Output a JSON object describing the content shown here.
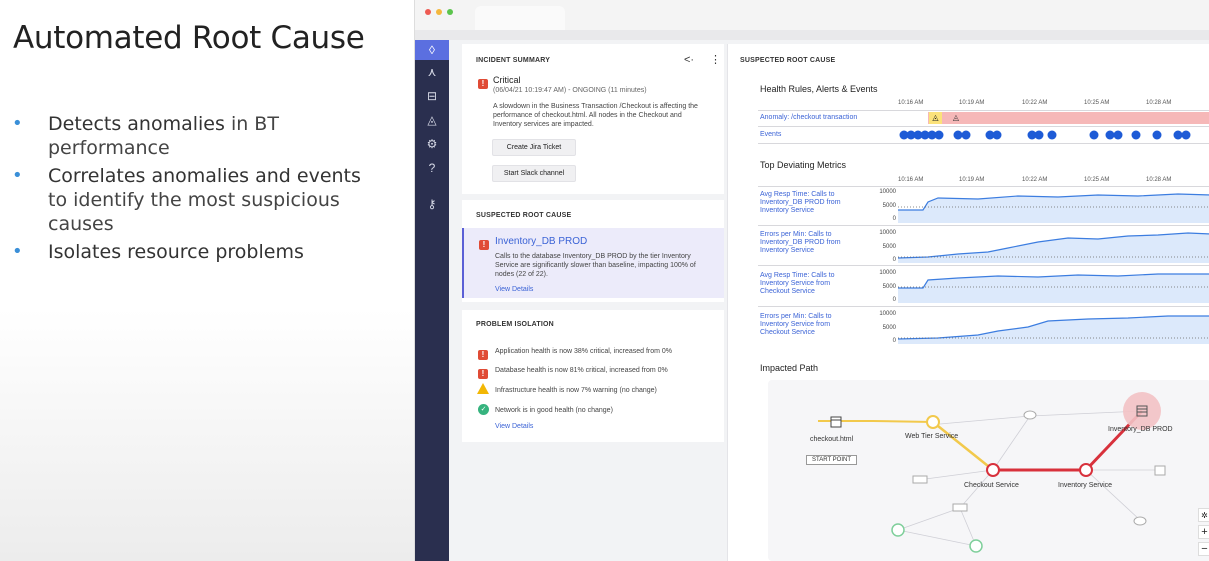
{
  "slide": {
    "title": "Automated Root Cause",
    "bullets": [
      {
        "text1": "Detects anomalies",
        "text2": " in BT",
        "text3": "performance"
      },
      {
        "text1": "Correlates anomalies and events",
        "text2": "to identify the most suspicious",
        "text3": "causes"
      },
      {
        "text1": "Isolates resource problems",
        "text2": "",
        "text3": ""
      }
    ]
  },
  "colors": {
    "accent": "#3b63d6",
    "critical": "#e04b35",
    "warning": "#f2b705",
    "ok": "#36b37e",
    "nav": "#2a2f4f",
    "nav_active": "#5b6fe0",
    "anomaly": "#f6b8b8",
    "path_bad": "#d8313c",
    "path_warn": "#f2c94c"
  },
  "incident": {
    "title": "INCIDENT SUMMARY",
    "severity": "Critical",
    "timestamp": "(06/04/21 10:19:47 AM) - ONGOING (11 minutes)",
    "desc1": "A slowdown in the Business Transaction /Checkout is affecting the",
    "desc2": "performance of checkout.html. All nodes in the Checkout and",
    "desc3": "Inventory services are impacted.",
    "btn_jira": "Create Jira Ticket",
    "btn_slack": "Start Slack channel"
  },
  "suspected_small": {
    "title": "SUSPECTED ROOT CAUSE",
    "name": "Inventory_DB PROD",
    "desc1": "Calls to the database Inventory_DB PROD by the tier Inventory",
    "desc2": "Service are significantly slower than baseline, impacting 100% of",
    "desc3": "nodes (22 of 22).",
    "view": "View Details"
  },
  "isolation": {
    "title": "PROBLEM ISOLATION",
    "items": [
      {
        "status": "critical",
        "text": "Application health is now 38% critical, increased from 0%"
      },
      {
        "status": "critical",
        "text": "Database health is now 81% critical, increased from 0%"
      },
      {
        "status": "warning",
        "text": "Infrastructure health is now 7% warning (no change)"
      },
      {
        "status": "ok",
        "text": "Network is in good health (no change)"
      }
    ],
    "view": "View Details"
  },
  "right": {
    "title": "SUSPECTED ROOT CAUSE",
    "health_title": "Health Rules, Alerts & Events",
    "times": [
      "10:16 AM",
      "10:19 AM",
      "10:22 AM",
      "10:25 AM",
      "10:28 AM"
    ],
    "anomaly_label": "Anomaly: /checkout transaction",
    "events_label": "Events",
    "metrics_title": "Top Deviating Metrics",
    "metrics": [
      {
        "l1": "Avg Resp Time: Calls to",
        "l2": "Inventory_DB PROD from",
        "l3": "Inventory Service"
      },
      {
        "l1": "Errors per Min: Calls to",
        "l2": "Inventory_DB PROD from",
        "l3": "Inventory Service"
      },
      {
        "l1": "Avg Resp Time: Calls to",
        "l2": "Inventory Service from",
        "l3": "Checkout Service"
      },
      {
        "l1": "Errors per Min: Calls to",
        "l2": "Inventory Service from",
        "l3": "Checkout Service"
      }
    ],
    "axis": [
      "10000",
      "5000",
      "0"
    ],
    "path_title": "Impacted Path",
    "nodes": {
      "checkout": "checkout.html",
      "start": "START POINT",
      "web": "Web Tier Service",
      "checkout_svc": "Checkout Service",
      "inventory_svc": "Inventory Service",
      "db": "Inventory_DB PROD"
    },
    "zoom_in": "+",
    "zoom_out": "−"
  }
}
